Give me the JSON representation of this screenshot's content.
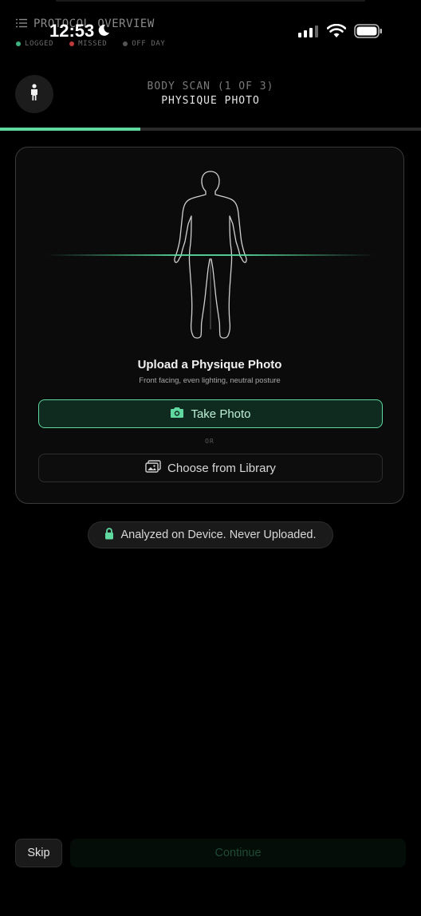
{
  "background_header": {
    "title": "PROTOCOL OVERVIEW",
    "legend": [
      {
        "label": "LOGGED",
        "color": "#3fb37f"
      },
      {
        "label": "MISSED",
        "color": "#c0393b"
      },
      {
        "label": "OFF DAY",
        "color": "#555555"
      }
    ]
  },
  "status_bar": {
    "time": "12:53"
  },
  "header": {
    "step": "BODY SCAN (1 OF 3)",
    "title": "PHYSIQUE PHOTO",
    "progress_fraction": 0.333
  },
  "card": {
    "title": "Upload a Physique Photo",
    "subtitle": "Front facing, even lighting, neutral posture",
    "primary_button": "Take Photo",
    "or_label": "OR",
    "secondary_button": "Choose from Library"
  },
  "privacy": {
    "label": "Analyzed on Device. Never Uploaded."
  },
  "footer": {
    "skip_label": "Skip",
    "continue_label": "Continue"
  },
  "colors": {
    "accent": "#5fd9a0",
    "background": "#000000"
  }
}
